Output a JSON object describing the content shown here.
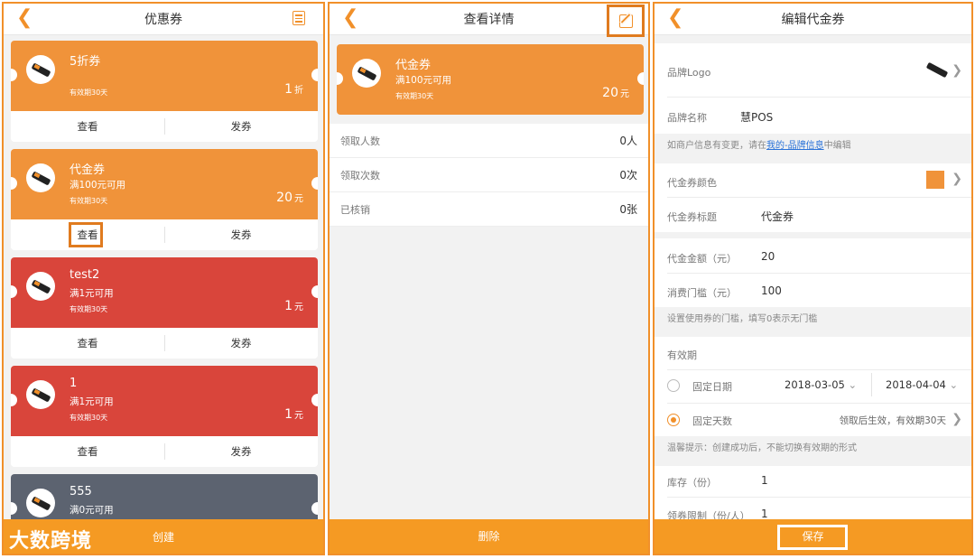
{
  "panel1": {
    "title": "优惠券",
    "coupons": [
      {
        "name": "5折券",
        "condition": "",
        "validity": "有效期30天",
        "value": "1",
        "unit": "折",
        "view_label": "查看",
        "issue_label": "发券",
        "color": "#f0933a"
      },
      {
        "name": "代金券",
        "condition": "满100元可用",
        "validity": "有效期30天",
        "value": "20",
        "unit": "元",
        "view_label": "查看",
        "issue_label": "发券",
        "color": "#f0933a"
      },
      {
        "name": "test2",
        "condition": "满1元可用",
        "validity": "有效期30天",
        "value": "1",
        "unit": "元",
        "view_label": "查看",
        "issue_label": "发券",
        "color": "#d9453b"
      },
      {
        "name": "1",
        "condition": "满1元可用",
        "validity": "有效期30天",
        "value": "1",
        "unit": "元",
        "view_label": "查看",
        "issue_label": "发券",
        "color": "#d9453b"
      },
      {
        "name": "555",
        "condition": "满0元可用",
        "validity": "",
        "value": "",
        "unit": "",
        "view_label": "",
        "issue_label": "",
        "color": "#5c6370"
      }
    ],
    "footer_label": "创建",
    "watermark": "大数跨境"
  },
  "panel2": {
    "title": "查看详情",
    "coupon": {
      "name": "代金券",
      "condition": "满100元可用",
      "validity": "有效期30天",
      "value": "20",
      "unit": "元"
    },
    "stats": [
      {
        "label": "领取人数",
        "value": "0人"
      },
      {
        "label": "领取次数",
        "value": "0次"
      },
      {
        "label": "已核销",
        "value": "0张"
      }
    ],
    "footer_label": "删除"
  },
  "panel3": {
    "title": "编辑代金券",
    "brand_logo_label": "品牌Logo",
    "brand_name_label": "品牌名称",
    "brand_name_value": "慧POS",
    "brand_note_prefix": "如商户信息有变更，请在",
    "brand_note_link": "我的-品牌信息",
    "brand_note_suffix": "中编辑",
    "color_label": "代金券颜色",
    "color_value": "#f0933a",
    "title_label": "代金券标题",
    "title_value": "代金券",
    "amount_label": "代金金额（元）",
    "amount_value": "20",
    "threshold_label": "消费门槛（元）",
    "threshold_value": "100",
    "threshold_note": "设置使用券的门槛，填写0表示无门槛",
    "validity_label": "有效期",
    "fixed_date_label": "固定日期",
    "start_date": "2018-03-05",
    "end_date": "2018-04-04",
    "fixed_days_label": "固定天数",
    "fixed_days_value": "领取后生效，有效期30天",
    "tip": "温馨提示：创建成功后，不能切换有效期的形式",
    "stock_label": "库存（份）",
    "stock_value": "1",
    "limit_label": "领券限制（份/人）",
    "limit_value": "1",
    "save_label": "保存"
  }
}
